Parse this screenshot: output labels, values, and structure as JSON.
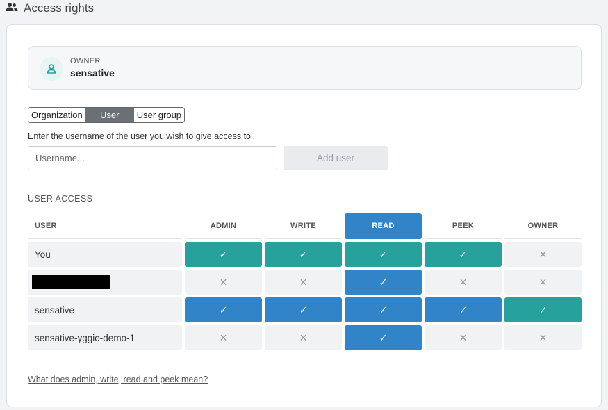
{
  "header": {
    "title": "Access rights",
    "icon": "users-icon"
  },
  "owner": {
    "label": "OWNER",
    "name": "sensative",
    "icon": "user-icon"
  },
  "tabs": [
    {
      "label": "Organization",
      "active": false
    },
    {
      "label": "User",
      "active": true
    },
    {
      "label": "User group",
      "active": false
    }
  ],
  "form": {
    "hint": "Enter the username of the user you wish to give access to",
    "placeholder": "Username...",
    "value": "",
    "add_label": "Add user"
  },
  "access": {
    "title": "USER ACCESS",
    "columns": [
      "USER",
      "ADMIN",
      "WRITE",
      "READ",
      "PEEK",
      "OWNER"
    ],
    "highlighted_column": "READ",
    "rows": [
      {
        "user": "You",
        "redacted": false,
        "perms": [
          "yes",
          "yes",
          "yes",
          "yes",
          "no"
        ],
        "style": [
          "g",
          "g",
          "g",
          "g",
          "n"
        ]
      },
      {
        "user": "",
        "redacted": true,
        "perms": [
          "no",
          "no",
          "yes",
          "no",
          "no"
        ],
        "style": [
          "n",
          "n",
          "b",
          "n",
          "n"
        ]
      },
      {
        "user": "sensative",
        "redacted": false,
        "perms": [
          "yes",
          "yes",
          "yes",
          "yes",
          "yes"
        ],
        "style": [
          "b",
          "b",
          "b",
          "b",
          "g"
        ]
      },
      {
        "user": "sensative-yggio-demo-1",
        "redacted": false,
        "perms": [
          "no",
          "no",
          "yes",
          "no",
          "no"
        ],
        "style": [
          "n",
          "n",
          "b",
          "n",
          "n"
        ]
      }
    ],
    "symbols": {
      "yes": "✓",
      "no": "✕"
    }
  },
  "help_link": "What does admin, write, read and peek mean?",
  "colors": {
    "teal": "#26a19c",
    "blue": "#3184c8",
    "muted": "#f1f2f4"
  }
}
